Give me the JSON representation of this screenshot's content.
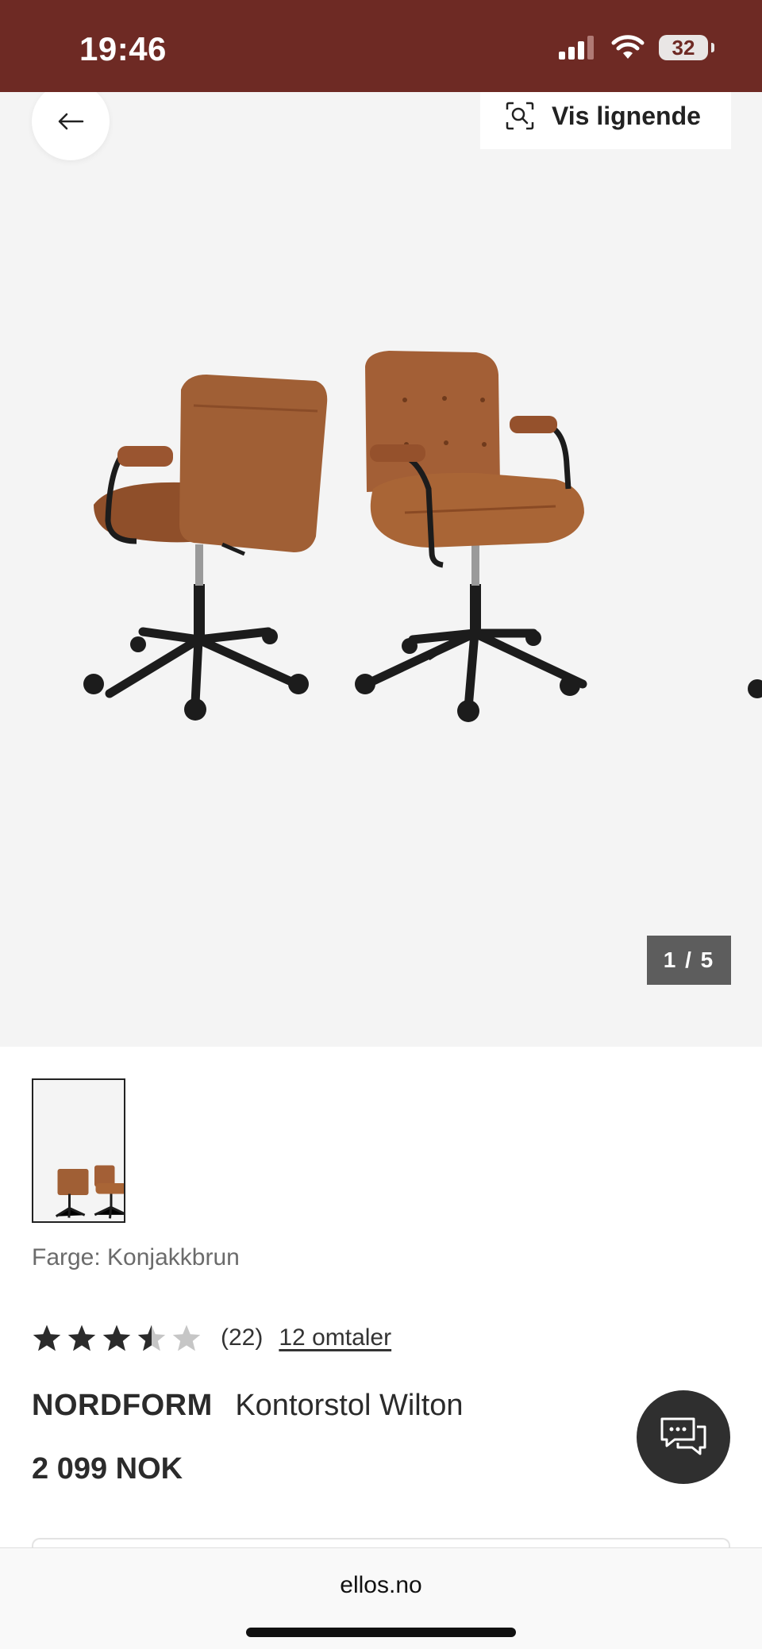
{
  "status_bar": {
    "time": "19:46",
    "battery": "32"
  },
  "gallery": {
    "similar_label": "Vis lignende",
    "counter": "1 / 5"
  },
  "product": {
    "color_label": "Farge: Konjakkbrun",
    "rating_value": 3.5,
    "rating_count": "(22)",
    "reviews_link": "12 omtaler",
    "brand": "NORDFORM",
    "name": "Kontorstol Wilton",
    "price": "2 099 NOK"
  },
  "browser": {
    "url": "ellos.no"
  },
  "colors": {
    "status_bar": "#6e2a24",
    "leather": "#9b5a32",
    "frame": "#1c1c1c"
  },
  "icons": [
    "back-arrow-icon",
    "visual-search-icon",
    "chat-icon",
    "signal-icon",
    "wifi-icon",
    "battery-icon",
    "star-icon"
  ]
}
